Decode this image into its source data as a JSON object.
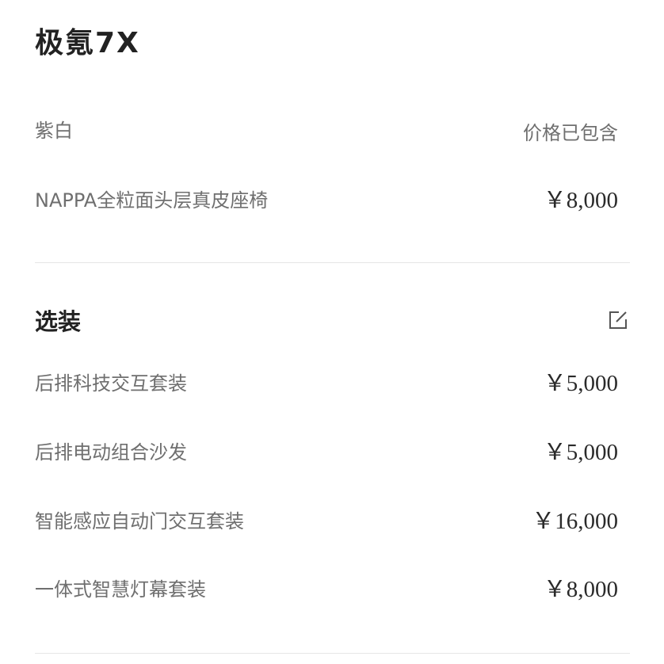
{
  "title": "极氪7X",
  "base_config": [
    {
      "label": "紫白",
      "value": "价格已包含"
    },
    {
      "label": "NAPPA全粒面头层真皮座椅",
      "value": "￥8,000"
    }
  ],
  "options_section": {
    "title": "选装",
    "edit_icon": "edit-icon",
    "items": [
      {
        "label": "后排科技交互套装",
        "value": "￥5,000"
      },
      {
        "label": "后排电动组合沙发",
        "value": "￥5,000"
      },
      {
        "label": "智能感应自动门交互套装",
        "value": "￥16,000"
      },
      {
        "label": "一体式智慧灯幕套装",
        "value": "￥8,000"
      }
    ]
  }
}
